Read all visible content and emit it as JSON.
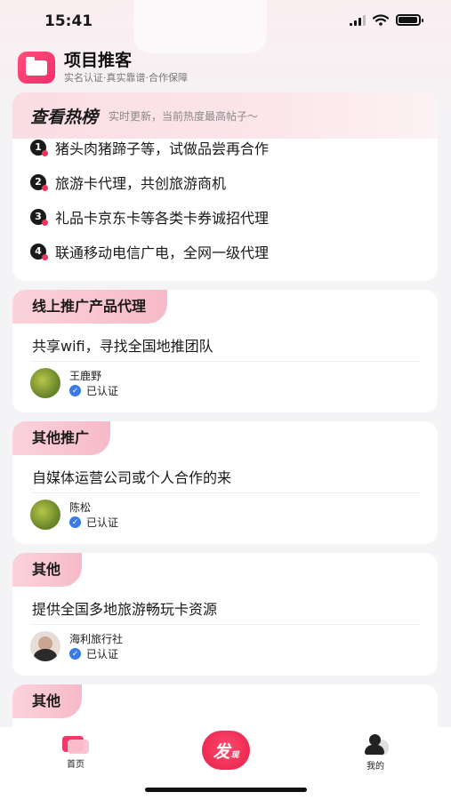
{
  "status_bar": {
    "time": "15:41"
  },
  "header": {
    "title": "项目推客",
    "subtitle": "实名认证·真实靠谱·合作保障"
  },
  "hot_list": {
    "title": "查看热榜",
    "subtitle": "实时更新，当前热度最高帖子～",
    "items": [
      {
        "num": "1",
        "text": "猪头肉猪蹄子等，试做品尝再合作"
      },
      {
        "num": "2",
        "text": "旅游卡代理，共创旅游商机"
      },
      {
        "num": "3",
        "text": "礼品卡京东卡等各类卡券诚招代理"
      },
      {
        "num": "4",
        "text": "联通移动电信广电，全网一级代理"
      }
    ]
  },
  "projects": [
    {
      "category": "线上推广产品代理",
      "title": "共享wifi，寻找全国地推团队",
      "author": "王鹿野",
      "verified": "已认证"
    },
    {
      "category": "其他推广",
      "title": "自媒体运营公司或个人合作的来",
      "author": "陈松",
      "verified": "已认证"
    },
    {
      "category": "其他",
      "title": "提供全国多地旅游畅玩卡资源",
      "author": "海利旅行社",
      "verified": "已认证"
    },
    {
      "category": "其他",
      "title": "",
      "author": "",
      "verified": ""
    }
  ],
  "tabbar": {
    "home": "首页",
    "discover_big": "发",
    "discover_small": "现",
    "me": "我的"
  },
  "colors": {
    "accent": "#f23360",
    "verified": "#3a7ae8"
  }
}
